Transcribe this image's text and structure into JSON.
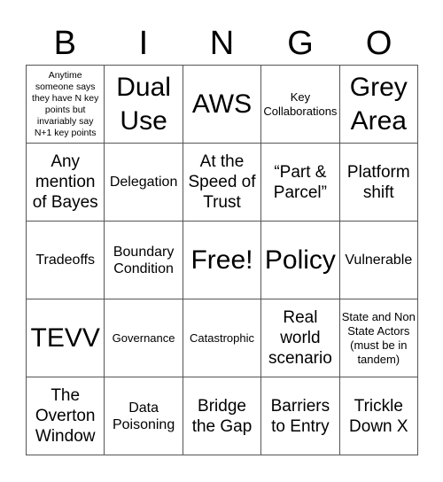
{
  "header": [
    "B",
    "I",
    "N",
    "G",
    "O"
  ],
  "cells": [
    {
      "text": "Anytime someone says they have N key points but invariably say N+1 key points",
      "size": "xs"
    },
    {
      "text": "Dual Use",
      "size": "xl"
    },
    {
      "text": "AWS",
      "size": "xl"
    },
    {
      "text": "Key Collaborations",
      "size": "s"
    },
    {
      "text": "Grey Area",
      "size": "xl"
    },
    {
      "text": "Any mention of Bayes",
      "size": "l"
    },
    {
      "text": "Delegation",
      "size": "m"
    },
    {
      "text": "At the Speed of Trust",
      "size": "l"
    },
    {
      "text": "“Part & Parcel”",
      "size": "l"
    },
    {
      "text": "Platform shift",
      "size": "l"
    },
    {
      "text": "Tradeoffs",
      "size": "m"
    },
    {
      "text": "Boundary Condition",
      "size": "m"
    },
    {
      "text": "Free!",
      "size": "xl"
    },
    {
      "text": "Policy",
      "size": "xl"
    },
    {
      "text": "Vulnerable",
      "size": "m"
    },
    {
      "text": "TEVV",
      "size": "xl"
    },
    {
      "text": "Governance",
      "size": "s"
    },
    {
      "text": "Catastrophic",
      "size": "s"
    },
    {
      "text": "Real world scenario",
      "size": "l"
    },
    {
      "text": "State and Non State Actors (must be in tandem)",
      "size": "s"
    },
    {
      "text": "The Overton Window",
      "size": "l"
    },
    {
      "text": "Data Poisoning",
      "size": "m"
    },
    {
      "text": "Bridge the Gap",
      "size": "l"
    },
    {
      "text": "Barriers to Entry",
      "size": "l"
    },
    {
      "text": "Trickle Down X",
      "size": "l"
    }
  ]
}
